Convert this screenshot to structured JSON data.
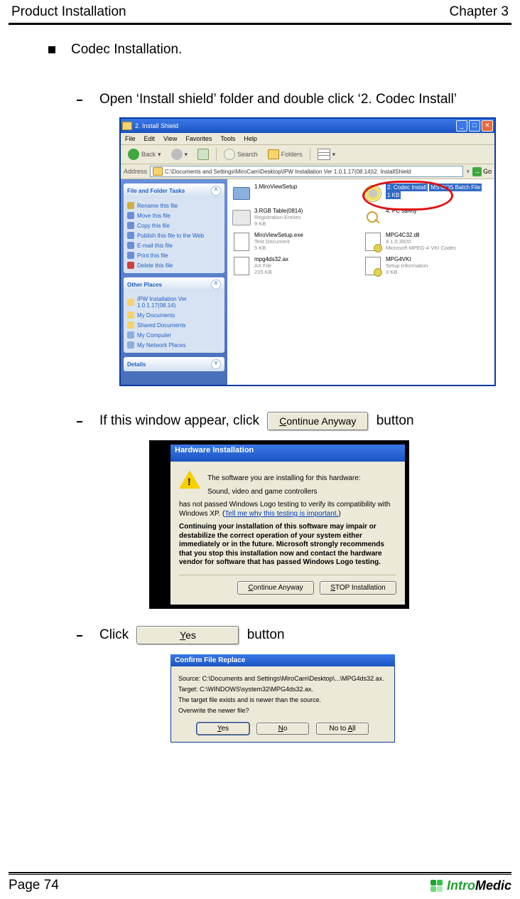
{
  "header": {
    "left": "Product Installation",
    "right": "Chapter 3"
  },
  "bullet_title": "Codec Installation.",
  "steps": {
    "one": "Open ‘Install shield’ folder and double click ‘2. Codec Install’",
    "two_pre": "If this window appear, click",
    "two_btn": "Continue Anyway",
    "two_post": "button",
    "three_pre": "Click",
    "three_btn": "Yes",
    "three_post": "button"
  },
  "explorer": {
    "title": "2. Install Shield",
    "menu": {
      "file": "File",
      "edit": "Edit",
      "view": "View",
      "favorites": "Favorites",
      "tools": "Tools",
      "help": "Help"
    },
    "toolbar": {
      "back": "Back",
      "search": "Search",
      "folders": "Folders"
    },
    "address_label": "Address",
    "address_path": "C:\\Documents and Settings\\MiroCam\\Desktop\\IPW Installation Ver 1.0.1.17(08.14)\\2. InstallShield",
    "go": "Go",
    "side": {
      "tasks_title": "File and Folder Tasks",
      "tasks": [
        "Rename this file",
        "Move this file",
        "Copy this file",
        "Publish this file to the Web",
        "E-mail this file",
        "Print this file",
        "Delete this file"
      ],
      "other_title": "Other Places",
      "other": [
        "IPW Installation Ver 1.0.1.17(08.14)",
        "My Documents",
        "Shared Documents",
        "My Computer",
        "My Network Places"
      ],
      "details_title": "Details"
    },
    "files": {
      "f1": {
        "name": "1.MiroViewSetup"
      },
      "f2": {
        "name": "2. Codec Install",
        "meta1": "MS-DOS Batch File",
        "meta2": "1 KB"
      },
      "f3": {
        "name": "3.RGB Table(0814)",
        "meta1": "Registration Entries",
        "meta2": "9 KB"
      },
      "f4": {
        "name": "4. PC safety"
      },
      "f5": {
        "name": "MiroViewSetup.exe",
        "meta1": "Text Document",
        "meta2": "5 KB"
      },
      "f6": {
        "name": "MPG4C32.dll",
        "meta1": "4.1.0.3920",
        "meta2": "Microsoft MPEG-4  VKI Codec"
      },
      "f7": {
        "name": "mpg4ds32.ax",
        "meta1": "AX File",
        "meta2": "235 KB"
      },
      "f8": {
        "name": "MPG4VKI",
        "meta1": "Setup Information",
        "meta2": "3 KB"
      }
    }
  },
  "hw": {
    "title": "Hardware Installation",
    "l1": "The software you are installing for this hardware:",
    "l2": "Sound, video and game controllers",
    "l3a": "has not passed Windows Logo testing to verify its compatibility with Windows XP. (",
    "l3link": "Tell me why this testing is important.",
    "l3b": ")",
    "bold": "Continuing your installation of this software may impair or destabilize the correct operation of your system either immediately or in the future. Microsoft strongly recommends that you stop this installation now and contact the hardware vendor for software that has passed Windows Logo testing.",
    "cont": "Continue Anyway",
    "stop": "STOP Installation"
  },
  "cfr": {
    "title": "Confirm File Replace",
    "source": "Source: C:\\Documents and Settings\\MiroCam\\Desktop\\...\\MPG4ds32.ax.",
    "target": "Target: C:\\WINDOWS\\system32\\MPG4ds32.ax.",
    "l1": "The target file exists and is newer than the source.",
    "l2": "Overwrite the newer file?",
    "yes": "Yes",
    "no": "No",
    "notoall": "No to All"
  },
  "footer": {
    "page": "Page 74",
    "brand1": "Intro",
    "brand2": "Medic"
  }
}
